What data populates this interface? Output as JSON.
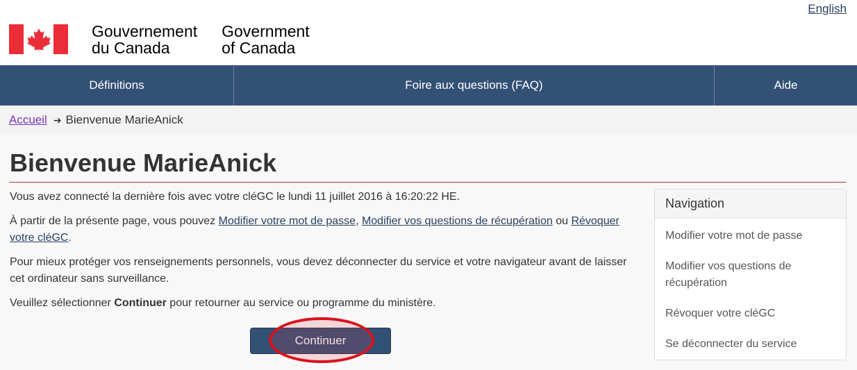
{
  "header": {
    "language_link": "English",
    "signature_fr": [
      "Gouvernement",
      "du Canada"
    ],
    "signature_en": [
      "Government",
      "of Canada"
    ],
    "flag_colors": {
      "red": "#eb2d37",
      "white": "#ffffff"
    }
  },
  "menu": {
    "items": [
      {
        "label": "Définitions"
      },
      {
        "label": "Foire aux questions (FAQ)"
      },
      {
        "label": "Aide"
      }
    ]
  },
  "breadcrumb": {
    "home": "Accueil",
    "arrow": "➔",
    "current": "Bienvenue MarieAnick"
  },
  "main": {
    "title": "Bienvenue MarieAnick",
    "p1": "Vous avez connecté la dernière fois avec votre cléGC le lundi 11 juillet 2016 à 16:20:22 HE.",
    "p2_prefix": "À partir de la présente page, vous pouvez ",
    "p2_link1": "Modifier votre mot de passe",
    "p2_sep": ", ",
    "p2_link2": "Modifier vos questions de récupération",
    "p2_or": " ou ",
    "p2_link3": "Révoquer votre cléGC",
    "p2_end": ".",
    "p3": "Pour mieux protéger vos renseignements personnels, vous devez déconnecter du service et votre navigateur avant de laisser cet ordinateur sans surveillance.",
    "p4_prefix": "Veuillez sélectionner ",
    "p4_bold": "Continuer",
    "p4_suffix": " pour retourner au service ou programme du ministère.",
    "continue_button": "Continuer"
  },
  "navigation": {
    "heading": "Navigation",
    "items": [
      {
        "label": "Modifier votre mot de passe"
      },
      {
        "label": "Modifier vos questions de récupération"
      },
      {
        "label": "Révoquer votre cléGC"
      },
      {
        "label": "Se déconnecter du service"
      }
    ]
  },
  "colors": {
    "menu_bg": "#335075",
    "title_rule": "#af3c43",
    "highlight": "#d9121c",
    "visited_link": "#7834bc"
  }
}
